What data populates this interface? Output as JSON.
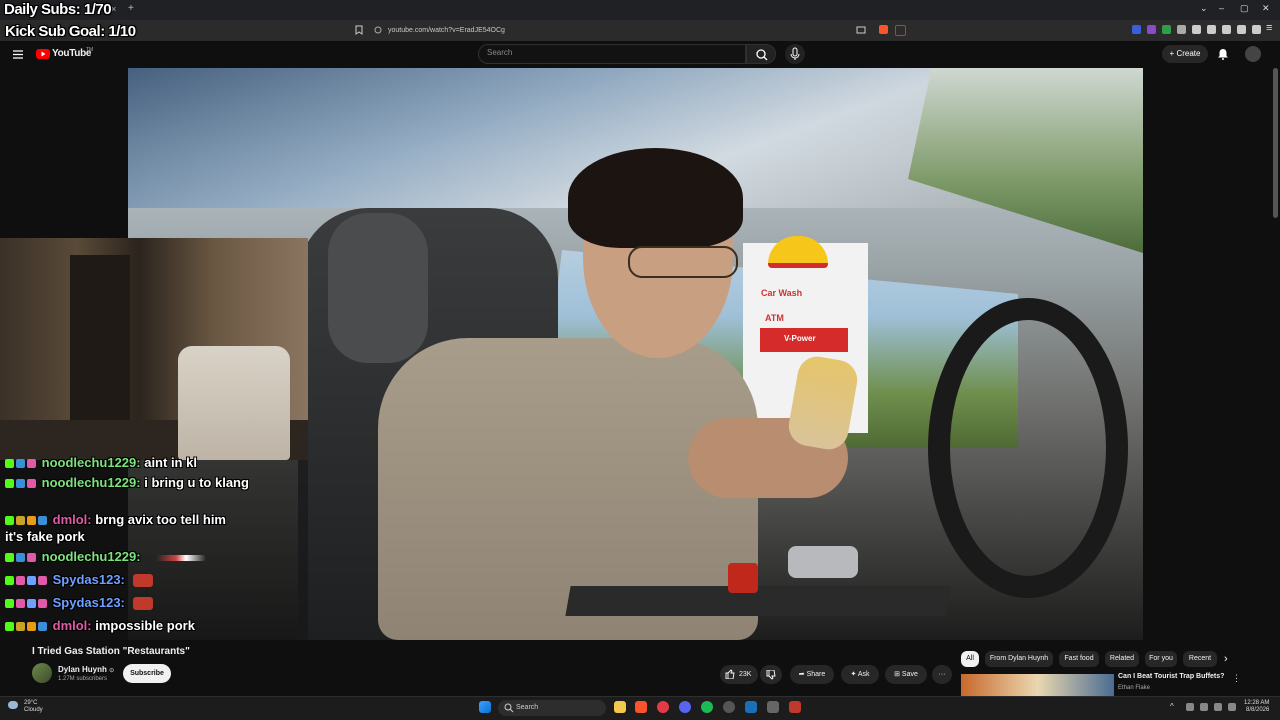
{
  "browser": {
    "url": "youtube.com/watch?v=EradJE54OCg",
    "tab_close": "×",
    "tab_new": "+",
    "window_controls": [
      "⌄",
      "–",
      "▢",
      "✕"
    ]
  },
  "overlay": {
    "daily_subs": "Daily Subs: 1/70",
    "kick_goal": "Kick Sub Goal: 1/10"
  },
  "youtube": {
    "logo": "YouTube",
    "logo_sup": "TM",
    "search_placeholder": "Search",
    "create_label": "Create"
  },
  "chat": [
    {
      "user": "noodlechu1229:",
      "msg": "aint in kl",
      "user_color": "#7ce37c"
    },
    {
      "user": "noodlechu1229:",
      "msg": "i bring u to klang",
      "user_color": "#7ce37c"
    },
    {
      "user": "dmlol:",
      "msg": "brng avix too tell him",
      "msg2": "it's fake pork",
      "user_color": "#e05aa8"
    },
    {
      "user": "noodlechu1229:",
      "msg": "",
      "user_color": "#7ce37c"
    },
    {
      "user": "Spydas123:",
      "msg": "",
      "user_color": "#6ea0ff"
    },
    {
      "user": "Spydas123:",
      "msg": "",
      "user_color": "#6ea0ff"
    },
    {
      "user": "dmlol:",
      "msg": "impossible pork",
      "user_color": "#e05aa8"
    }
  ],
  "video": {
    "sign_text": [
      "Car Wash",
      "ATM",
      "V-Power"
    ],
    "title": "I Tried Gas Station \"Restaurants\"",
    "channel": "Dylan Huynh",
    "verified": "⊙",
    "subscribers": "1.27M subscribers",
    "subscribe_label": "Subscribe",
    "likes": "23K",
    "share_label": "Share",
    "ask_label": "Ask",
    "save_label": "Save",
    "more_label": "···"
  },
  "chips": [
    "All",
    "From Dylan Huynh",
    "Fast food",
    "Related",
    "For you",
    "Recent"
  ],
  "recommendation": {
    "title": "Can I Beat Tourist Trap Buffets?",
    "channel": "Ethan Flake"
  },
  "taskbar": {
    "weather_temp": "29°C",
    "weather_desc": "Cloudy",
    "search_label": "Search",
    "time": "12:28 AM",
    "date": "8/8/2026"
  },
  "colors": {
    "brand_red": "#ff0000",
    "kick_green": "#53fc18"
  }
}
